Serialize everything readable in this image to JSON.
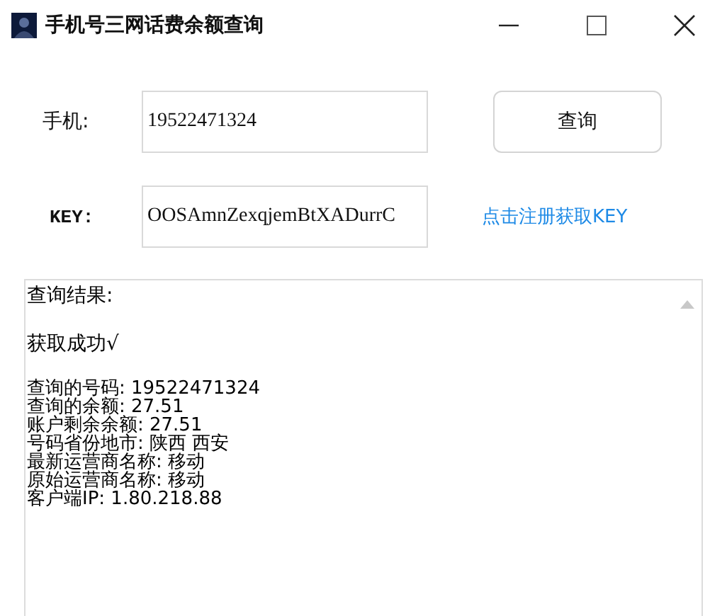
{
  "window": {
    "title": "手机号三网话费余额查询"
  },
  "phone": {
    "label": "手机:",
    "value": "19522471324"
  },
  "query_button": {
    "label": "查询"
  },
  "key": {
    "label": "KEY:",
    "value": "OOSAmnZexqjemBtXADurrC"
  },
  "register_link": {
    "label": "点击注册获取KEY"
  },
  "result": {
    "heading": "查询结果:",
    "status": "获取成功√",
    "details": [
      "查询的号码: 19522471324",
      "查询的余额: 27.51",
      "账户剩余余额: 27.51",
      "号码省份地市: 陕西 西安",
      "最新运营商名称: 移动",
      "原始运营商名称: 移动",
      "客户端IP: 1.80.218.88"
    ]
  }
}
